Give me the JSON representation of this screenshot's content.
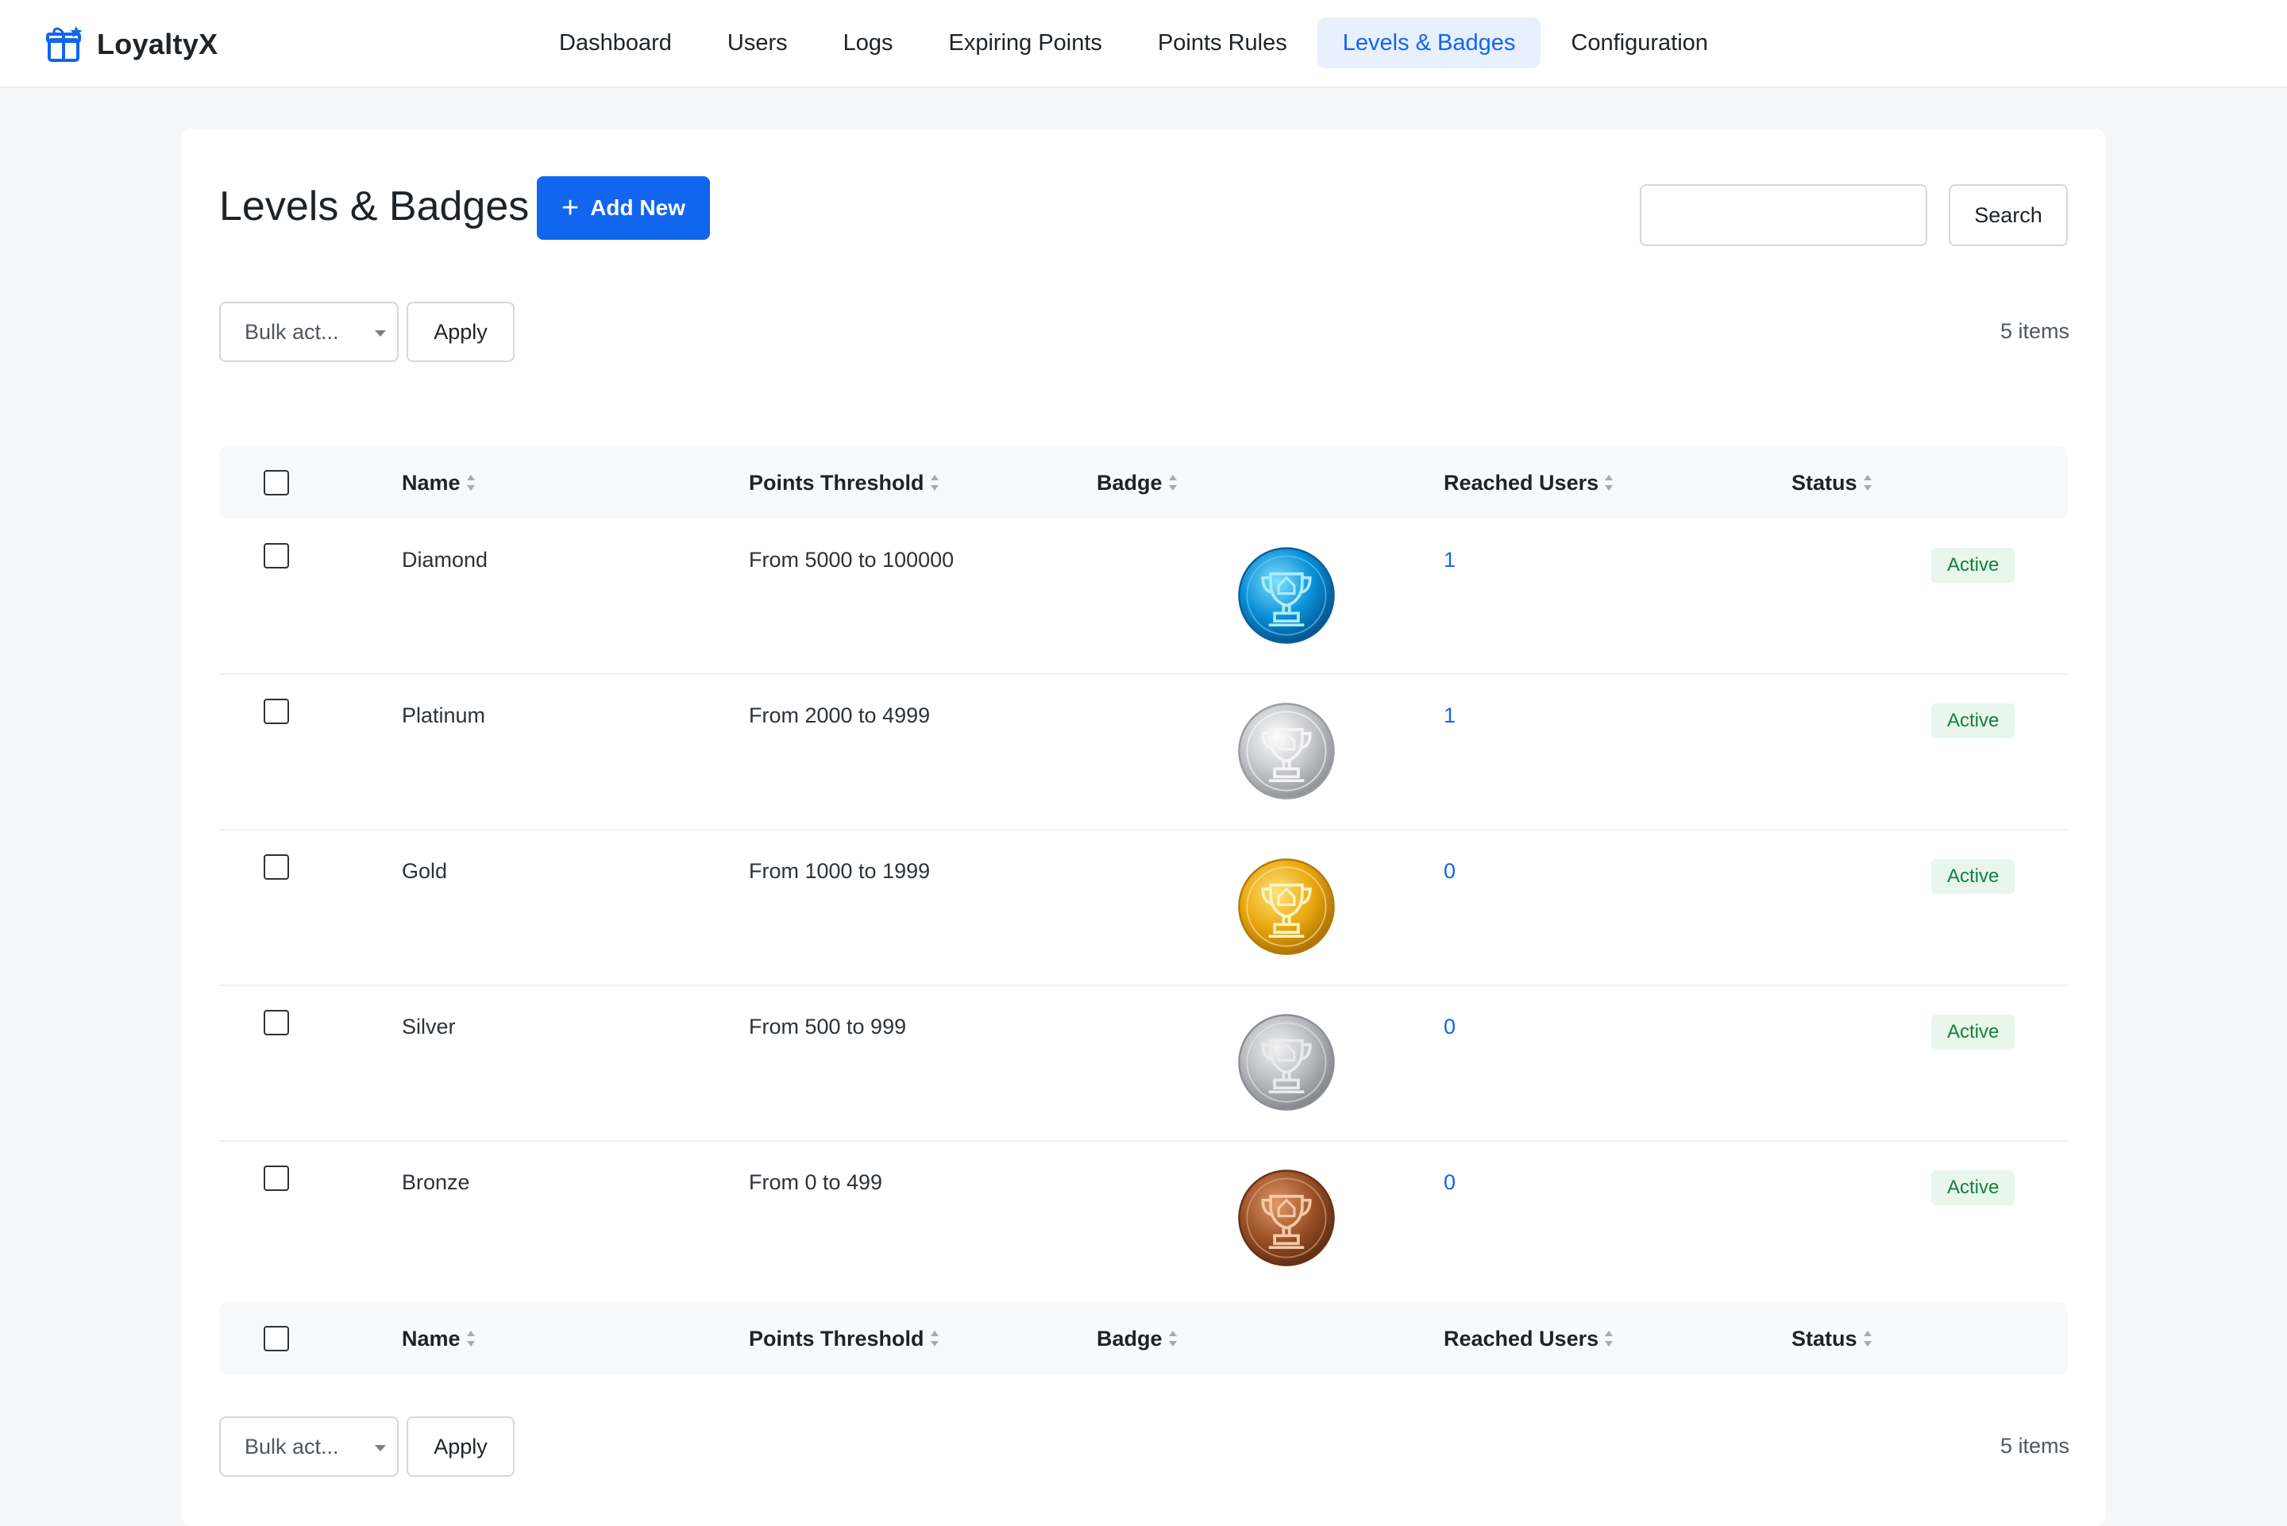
{
  "app": {
    "name": "LoyaltyX"
  },
  "nav": [
    {
      "label": "Dashboard",
      "active": false
    },
    {
      "label": "Users",
      "active": false
    },
    {
      "label": "Logs",
      "active": false
    },
    {
      "label": "Expiring Points",
      "active": false
    },
    {
      "label": "Points Rules",
      "active": false
    },
    {
      "label": "Levels & Badges",
      "active": true
    },
    {
      "label": "Configuration",
      "active": false
    }
  ],
  "page": {
    "title": "Levels & Badges",
    "add_label": "Add New",
    "search_value": "",
    "search_label": "Search",
    "bulk_label": "Bulk act...",
    "apply_label": "Apply",
    "items_count": "5 items"
  },
  "table": {
    "columns": [
      "Name",
      "Points Threshold",
      "Badge",
      "Reached Users",
      "Status"
    ],
    "rows": [
      {
        "name": "Diamond",
        "threshold": "From 5000 to 100000",
        "badge": "diamond-trophy-medal-icon",
        "users": "1",
        "status": "Active"
      },
      {
        "name": "Platinum",
        "threshold": "From 2000 to 4999",
        "badge": "platinum-trophy-medal-icon",
        "users": "1",
        "status": "Active"
      },
      {
        "name": "Gold",
        "threshold": "From 1000 to 1999",
        "badge": "gold-trophy-medal-icon",
        "users": "0",
        "status": "Active"
      },
      {
        "name": "Silver",
        "threshold": "From 500 to 999",
        "badge": "silver-trophy-medal-icon",
        "users": "0",
        "status": "Active"
      },
      {
        "name": "Bronze",
        "threshold": "From 0 to 499",
        "badge": "bronze-trophy-medal-icon",
        "users": "0",
        "status": "Active"
      }
    ]
  },
  "colors": {
    "accent": "#1165ee",
    "active_nav_bg": "#e8f0fd",
    "status_bg": "#e8f6ec",
    "status_text": "#15803d",
    "medal_diamond": "#0a8fd6",
    "medal_platinum": "#c4c6c9",
    "medal_gold": "#e9a80f",
    "medal_silver": "#b7b9bc",
    "medal_bronze": "#9b5228"
  }
}
